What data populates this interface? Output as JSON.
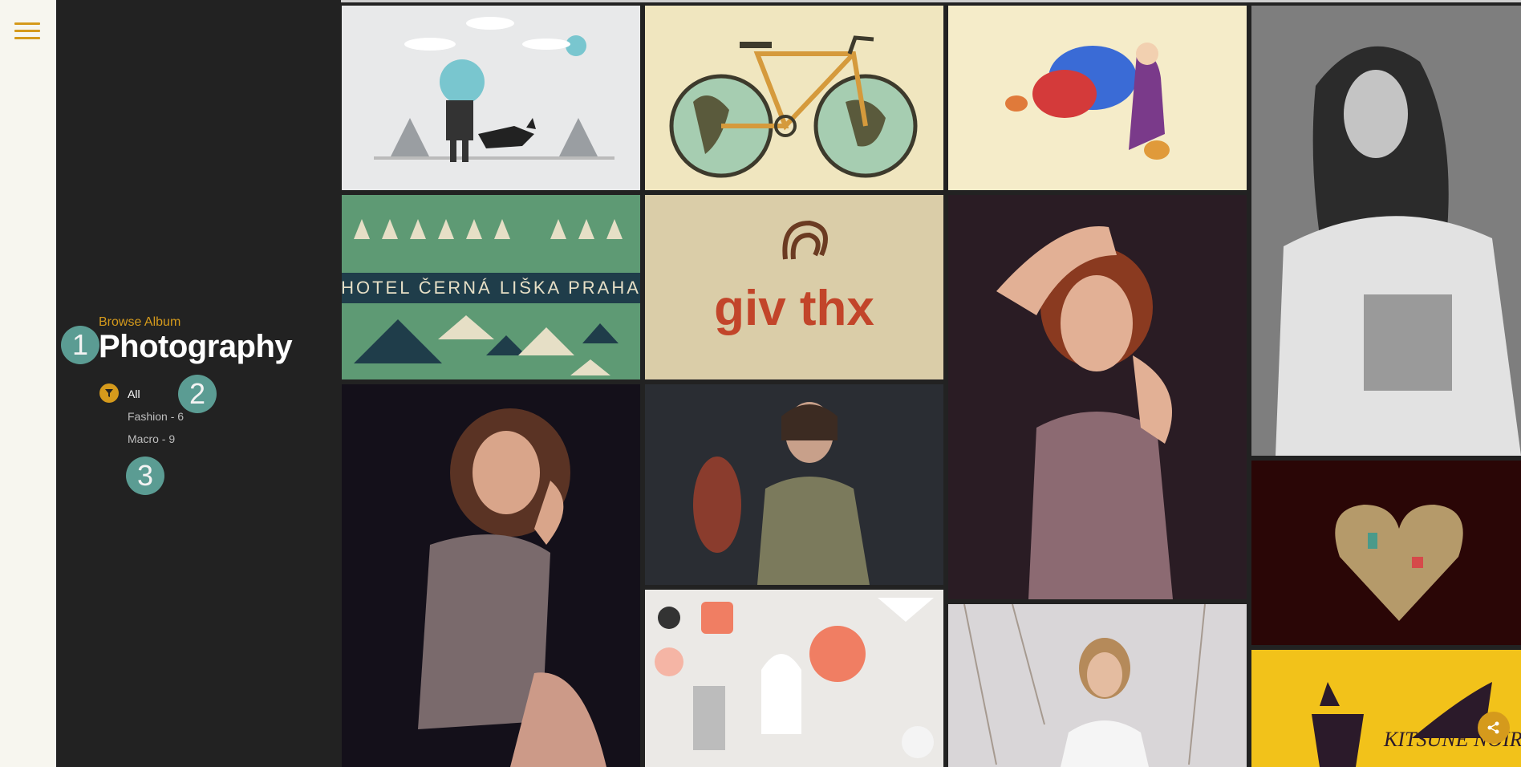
{
  "album": {
    "browse_label": "Browse Album",
    "title": "Photography"
  },
  "filters": [
    {
      "label": "All",
      "active": true
    },
    {
      "label": "Fashion - 6",
      "active": false
    },
    {
      "label": "Macro - 9",
      "active": false
    }
  ],
  "callouts": [
    "1",
    "2",
    "3"
  ],
  "gallery": {
    "hotel_caption": "HOTEL ČERNÁ LIŠKA PRAHA",
    "givthx_text": "giv thx",
    "kitsune_text": "KITSUNE NOIR"
  },
  "colors": {
    "accent": "#d59a1c",
    "sidebar_bg": "#222222",
    "rail_bg": "#f7f6ef",
    "callout": "#5fa39a"
  },
  "icons": {
    "menu": "hamburger-icon",
    "filter": "filter-icon",
    "share": "share-icon"
  }
}
